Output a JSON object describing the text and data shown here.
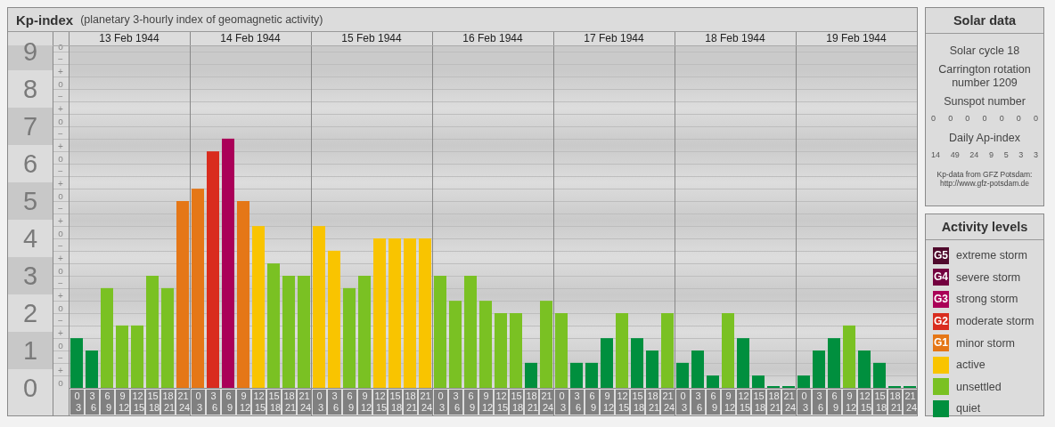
{
  "header": {
    "title": "Kp-index",
    "subtitle": "(planetary 3-hourly index of geomagnetic activity)"
  },
  "chart": {
    "days": [
      "13 Feb 1944",
      "14 Feb 1944",
      "15 Feb 1944",
      "16 Feb 1944",
      "17 Feb 1944",
      "18 Feb 1944",
      "19 Feb 1944"
    ],
    "minor_ticks": [
      "o",
      "−",
      "+",
      "o",
      "−",
      "+",
      "o",
      "−",
      "+",
      "o",
      "−",
      "+",
      "o",
      "−",
      "+",
      "o",
      "−",
      "+",
      "o",
      "−",
      "+",
      "o",
      "−",
      "+",
      "o",
      "−",
      "+",
      "o"
    ],
    "chart_data": {
      "type": "bar",
      "grid": true,
      "ylim": [
        0,
        9
      ],
      "yticks": [
        0,
        1,
        2,
        3,
        4,
        5,
        6,
        7,
        8,
        9
      ],
      "categories": [
        "0 3",
        "3 6",
        "6 9",
        "9 12",
        "12 15",
        "15 18",
        "18 21",
        "21 24",
        "0 3",
        "3 6",
        "6 9",
        "9 12",
        "12 15",
        "15 18",
        "18 21",
        "21 24",
        "0 3",
        "3 6",
        "6 9",
        "9 12",
        "12 15",
        "15 18",
        "18 21",
        "21 24",
        "0 3",
        "3 6",
        "6 9",
        "9 12",
        "12 15",
        "15 18",
        "18 21",
        "21 24",
        "0 3",
        "3 6",
        "6 9",
        "9 12",
        "12 15",
        "15 18",
        "18 21",
        "21 24",
        "0 3",
        "3 6",
        "6 9",
        "9 12",
        "12 15",
        "15 18",
        "18 21",
        "21 24",
        "0 3",
        "3 6",
        "6 9",
        "9 12",
        "12 15",
        "15 18",
        "18 21",
        "21 24"
      ],
      "series": [
        {
          "values": [
            1.33,
            1,
            2.67,
            1.67,
            1.67,
            3,
            2.67,
            5,
            5.33,
            6.33,
            6.67,
            5,
            4.33,
            3.33,
            3,
            3,
            4.33,
            3.67,
            2.67,
            3,
            4,
            4,
            4,
            4,
            3,
            2.33,
            3,
            2.33,
            2,
            2,
            0.67,
            2.33,
            2,
            0.67,
            0.67,
            1.33,
            2,
            1.33,
            1,
            2,
            0.67,
            1,
            0.33,
            2,
            1.33,
            0.33,
            0,
            0,
            0.33,
            1,
            1.33,
            1.67,
            1,
            0.67,
            0,
            0
          ]
        }
      ]
    }
  },
  "solar": {
    "title": "Solar data",
    "cycle": "Solar cycle 18",
    "rotation": "Carrington rotation number 1209",
    "sunspot_label": "Sunspot number",
    "sunspots": [
      "0",
      "0",
      "0",
      "0",
      "0",
      "0",
      "0"
    ],
    "ap_label": "Daily Ap-index",
    "ap": [
      "14",
      "49",
      "24",
      "9",
      "5",
      "3",
      "3"
    ],
    "source": "Kp-data from GFZ Potsdam:",
    "source_url": "http://www.gfz-potsdam.de"
  },
  "legend": {
    "title": "Activity levels",
    "items": [
      {
        "badge": "G5",
        "label": "extreme storm",
        "color": "#4f0a2c"
      },
      {
        "badge": "G4",
        "label": "severe storm",
        "color": "#73003f"
      },
      {
        "badge": "G3",
        "label": "strong storm",
        "color": "#aa0058"
      },
      {
        "badge": "G2",
        "label": "moderate storm",
        "color": "#d92c1e"
      },
      {
        "badge": "G1",
        "label": "minor storm",
        "color": "#e57717"
      },
      {
        "label": "active",
        "color": "#f9c400"
      },
      {
        "label": "unsettled",
        "color": "#7ac123"
      },
      {
        "label": "quiet",
        "color": "#008f3e"
      }
    ]
  }
}
